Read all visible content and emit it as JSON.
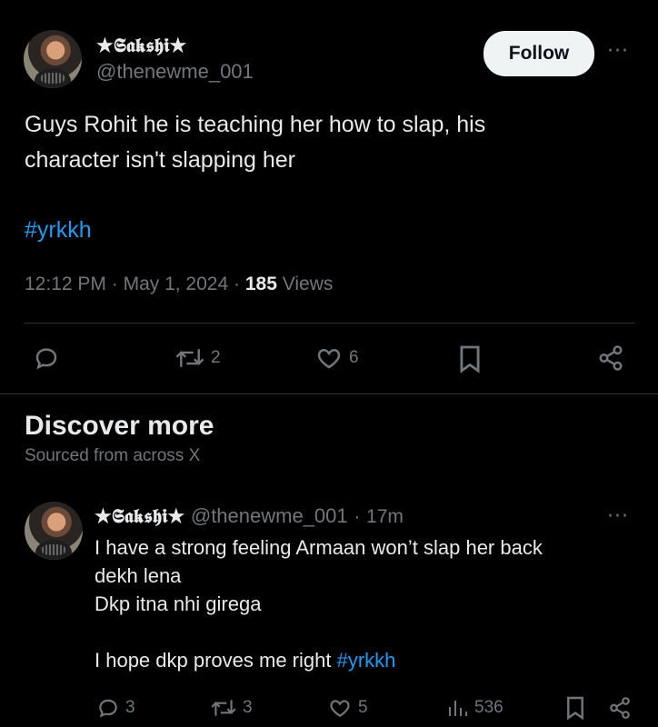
{
  "main_tweet": {
    "display_name": "★𝕾𝖆𝖐𝖘𝖍𝖎★",
    "handle": "@thenewme_001",
    "follow_label": "Follow",
    "more_label": "···",
    "text": "Guys Rohit  he is teaching her how to slap, his character isn't slapping her",
    "hashtag": "#yrkkh",
    "time": "12:12 PM",
    "sep1": "·",
    "date": "May 1, 2024",
    "sep2": "·",
    "views_count": "185",
    "views_label": "Views",
    "actions": {
      "reply_icon": "reply-icon",
      "retweet_icon": "retweet-icon",
      "retweet_count": "2",
      "like_icon": "heart-icon",
      "like_count": "6",
      "bookmark_icon": "bookmark-icon",
      "share_icon": "share-icon"
    }
  },
  "discover": {
    "title": "Discover more",
    "subtitle": "Sourced from across X"
  },
  "reply_tweet": {
    "display_name": "★𝕾𝖆𝖐𝖘𝖍𝖎★",
    "handle": "@thenewme_001",
    "sep": "·",
    "age": "17m",
    "more_label": "···",
    "text_before_hashtag": "I have a strong feeling Armaan won’t slap her back\ndekh lena\nDkp itna nhi girega\n\nI hope dkp proves me right ",
    "hashtag": "#yrkkh",
    "reply_count": "3",
    "retweet_count": "3",
    "like_count": "5",
    "views_count": "536"
  },
  "colors": {
    "background": "#000000",
    "text": "#e7e9ea",
    "muted": "#71767b",
    "link": "#1d9bf0",
    "divider": "#2f3336",
    "follow_bg": "#eff3f4"
  }
}
